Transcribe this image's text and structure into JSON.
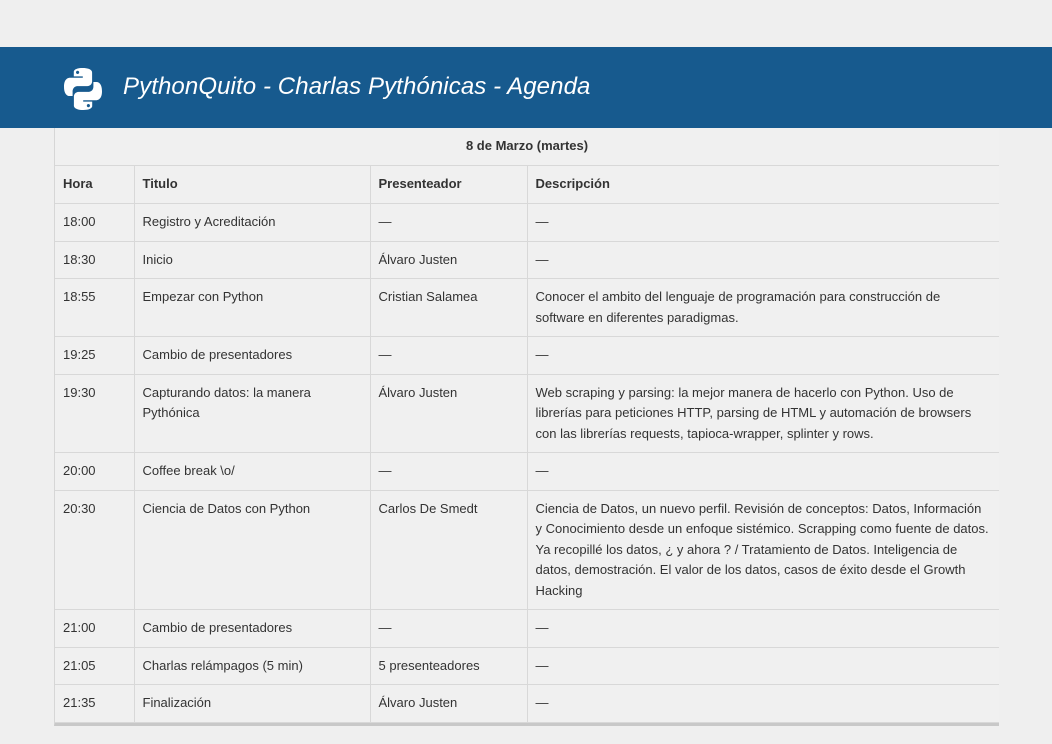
{
  "header": {
    "title": "PythonQuito - Charlas Pythónicas - Agenda",
    "logo_icon": "python-logo-icon",
    "background": "#175a8e"
  },
  "agenda": {
    "date": "8 de Marzo (martes)",
    "columns": [
      "Hora",
      "Titulo",
      "Presenteador",
      "Descripción"
    ],
    "rows": [
      {
        "hora": "18:00",
        "titulo": "Registro y Acreditación",
        "presentador": "—",
        "descripcion": "—"
      },
      {
        "hora": "18:30",
        "titulo": "Inicio",
        "presentador": "Álvaro Justen",
        "descripcion": "—"
      },
      {
        "hora": "18:55",
        "titulo": "Empezar con Python",
        "presentador": "Cristian Salamea",
        "descripcion": "Conocer el ambito del lenguaje de programación para construcción de software en diferentes paradigmas."
      },
      {
        "hora": "19:25",
        "titulo": "Cambio de presentadores",
        "presentador": "—",
        "descripcion": "—"
      },
      {
        "hora": "19:30",
        "titulo": "Capturando datos: la manera Pythónica",
        "presentador": "Álvaro Justen",
        "descripcion": "Web scraping y parsing: la mejor manera de hacerlo con Python. Uso de librerías para peticiones HTTP, parsing de HTML y automación de browsers con las librerías requests, tapioca-wrapper, splinter y rows."
      },
      {
        "hora": "20:00",
        "titulo": "Coffee break \\o/",
        "presentador": "—",
        "descripcion": "—"
      },
      {
        "hora": "20:30",
        "titulo": "Ciencia de Datos con Python",
        "presentador": "Carlos De Smedt",
        "descripcion": "Ciencia de Datos, un nuevo perfil. Revisión de conceptos: Datos, Información y Conocimiento desde un enfoque sistémico. Scrapping como fuente de datos. Ya recopillé los datos, ¿ y ahora ? / Tratamiento de Datos. Inteligencia de datos, demostración. El valor de los datos, casos de éxito desde el Growth Hacking"
      },
      {
        "hora": "21:00",
        "titulo": "Cambio de presentadores",
        "presentador": "—",
        "descripcion": "—"
      },
      {
        "hora": "21:05",
        "titulo": "Charlas relámpagos (5 min)",
        "presentador": "5 presenteadores",
        "descripcion": "—"
      },
      {
        "hora": "21:35",
        "titulo": "Finalización",
        "presentador": "Álvaro Justen",
        "descripcion": "—"
      }
    ]
  }
}
